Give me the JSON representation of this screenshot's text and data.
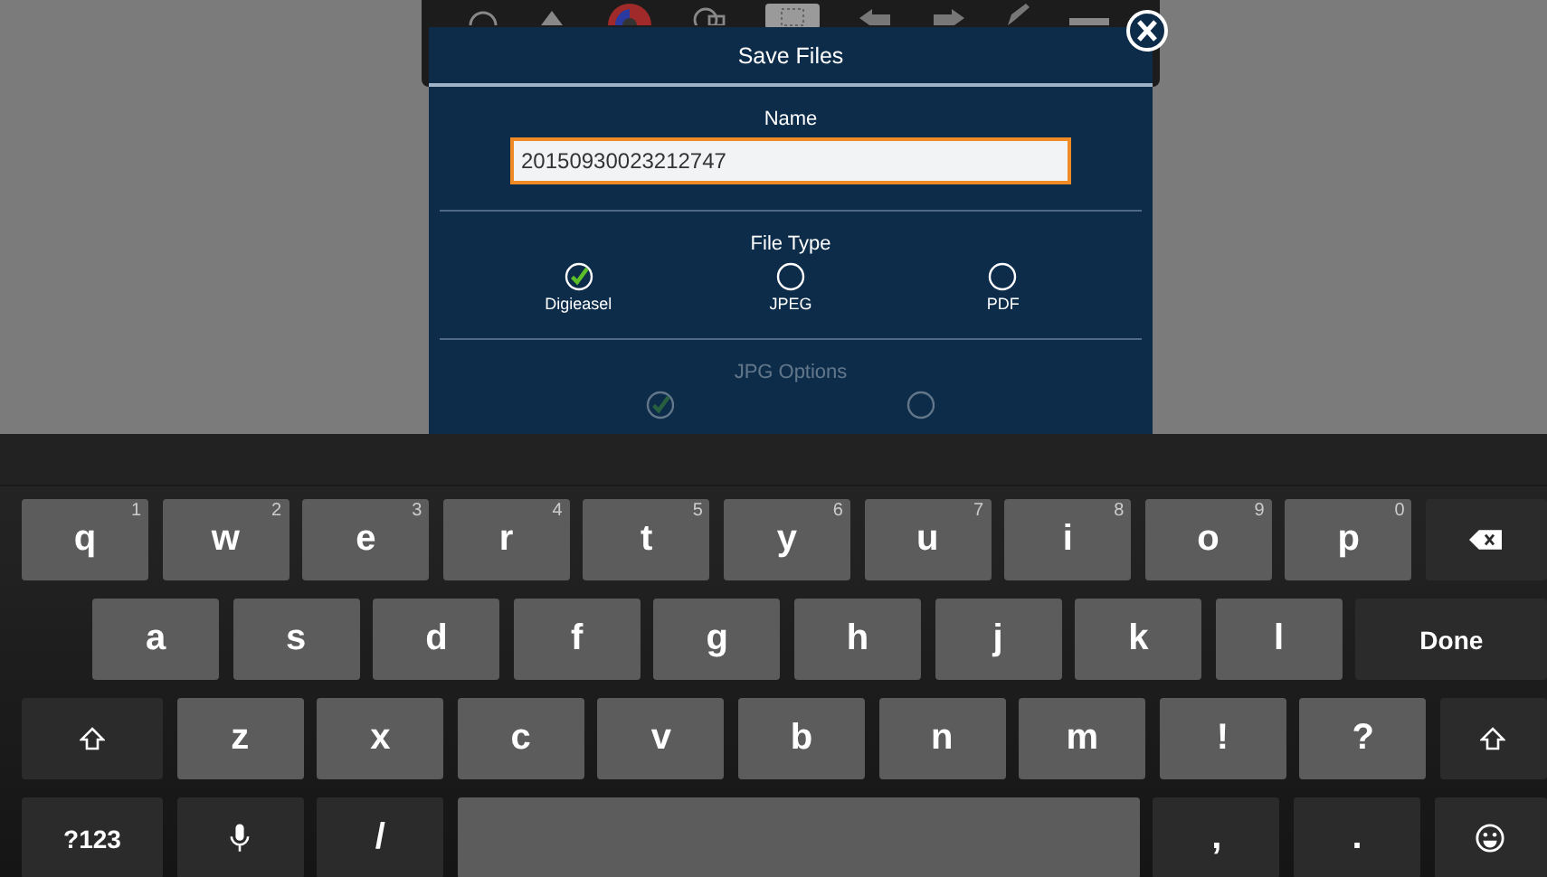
{
  "dialog": {
    "title": "Save Files",
    "name_field": {
      "label": "Name",
      "value": "20150930023212747",
      "focused": true
    },
    "file_type": {
      "label": "File Type",
      "options": [
        {
          "label": "Digieasel",
          "selected": true
        },
        {
          "label": "JPEG",
          "selected": false
        },
        {
          "label": "PDF",
          "selected": false
        }
      ]
    },
    "jpg_options": {
      "label": "JPG Options",
      "disabled": true,
      "options": [
        {
          "selected": true
        },
        {
          "selected": false
        }
      ]
    }
  },
  "keyboard": {
    "rows": [
      {
        "keys": [
          {
            "kind": "letter",
            "label": "q",
            "hint": "1"
          },
          {
            "kind": "letter",
            "label": "w",
            "hint": "2"
          },
          {
            "kind": "letter",
            "label": "e",
            "hint": "3"
          },
          {
            "kind": "letter",
            "label": "r",
            "hint": "4"
          },
          {
            "kind": "letter",
            "label": "t",
            "hint": "5"
          },
          {
            "kind": "letter",
            "label": "y",
            "hint": "6"
          },
          {
            "kind": "letter",
            "label": "u",
            "hint": "7"
          },
          {
            "kind": "letter",
            "label": "i",
            "hint": "8"
          },
          {
            "kind": "letter",
            "label": "o",
            "hint": "9"
          },
          {
            "kind": "letter",
            "label": "p",
            "hint": "0"
          },
          {
            "kind": "backspace"
          }
        ]
      },
      {
        "keys": [
          {
            "kind": "letter",
            "label": "a"
          },
          {
            "kind": "letter",
            "label": "s"
          },
          {
            "kind": "letter",
            "label": "d"
          },
          {
            "kind": "letter",
            "label": "f"
          },
          {
            "kind": "letter",
            "label": "g"
          },
          {
            "kind": "letter",
            "label": "h"
          },
          {
            "kind": "letter",
            "label": "j"
          },
          {
            "kind": "letter",
            "label": "k"
          },
          {
            "kind": "letter",
            "label": "l"
          },
          {
            "kind": "action",
            "label": "Done"
          }
        ]
      },
      {
        "keys": [
          {
            "kind": "shift"
          },
          {
            "kind": "letter",
            "label": "z"
          },
          {
            "kind": "letter",
            "label": "x"
          },
          {
            "kind": "letter",
            "label": "c"
          },
          {
            "kind": "letter",
            "label": "v"
          },
          {
            "kind": "letter",
            "label": "b"
          },
          {
            "kind": "letter",
            "label": "n"
          },
          {
            "kind": "letter",
            "label": "m"
          },
          {
            "kind": "letter",
            "label": "!"
          },
          {
            "kind": "letter",
            "label": "?"
          },
          {
            "kind": "shift"
          }
        ]
      },
      {
        "keys": [
          {
            "kind": "mode",
            "label": "?123"
          },
          {
            "kind": "mic"
          },
          {
            "kind": "symbol",
            "label": "/"
          },
          {
            "kind": "space"
          },
          {
            "kind": "symbol",
            "label": ","
          },
          {
            "kind": "symbol",
            "label": "."
          },
          {
            "kind": "emoji"
          }
        ]
      }
    ]
  }
}
